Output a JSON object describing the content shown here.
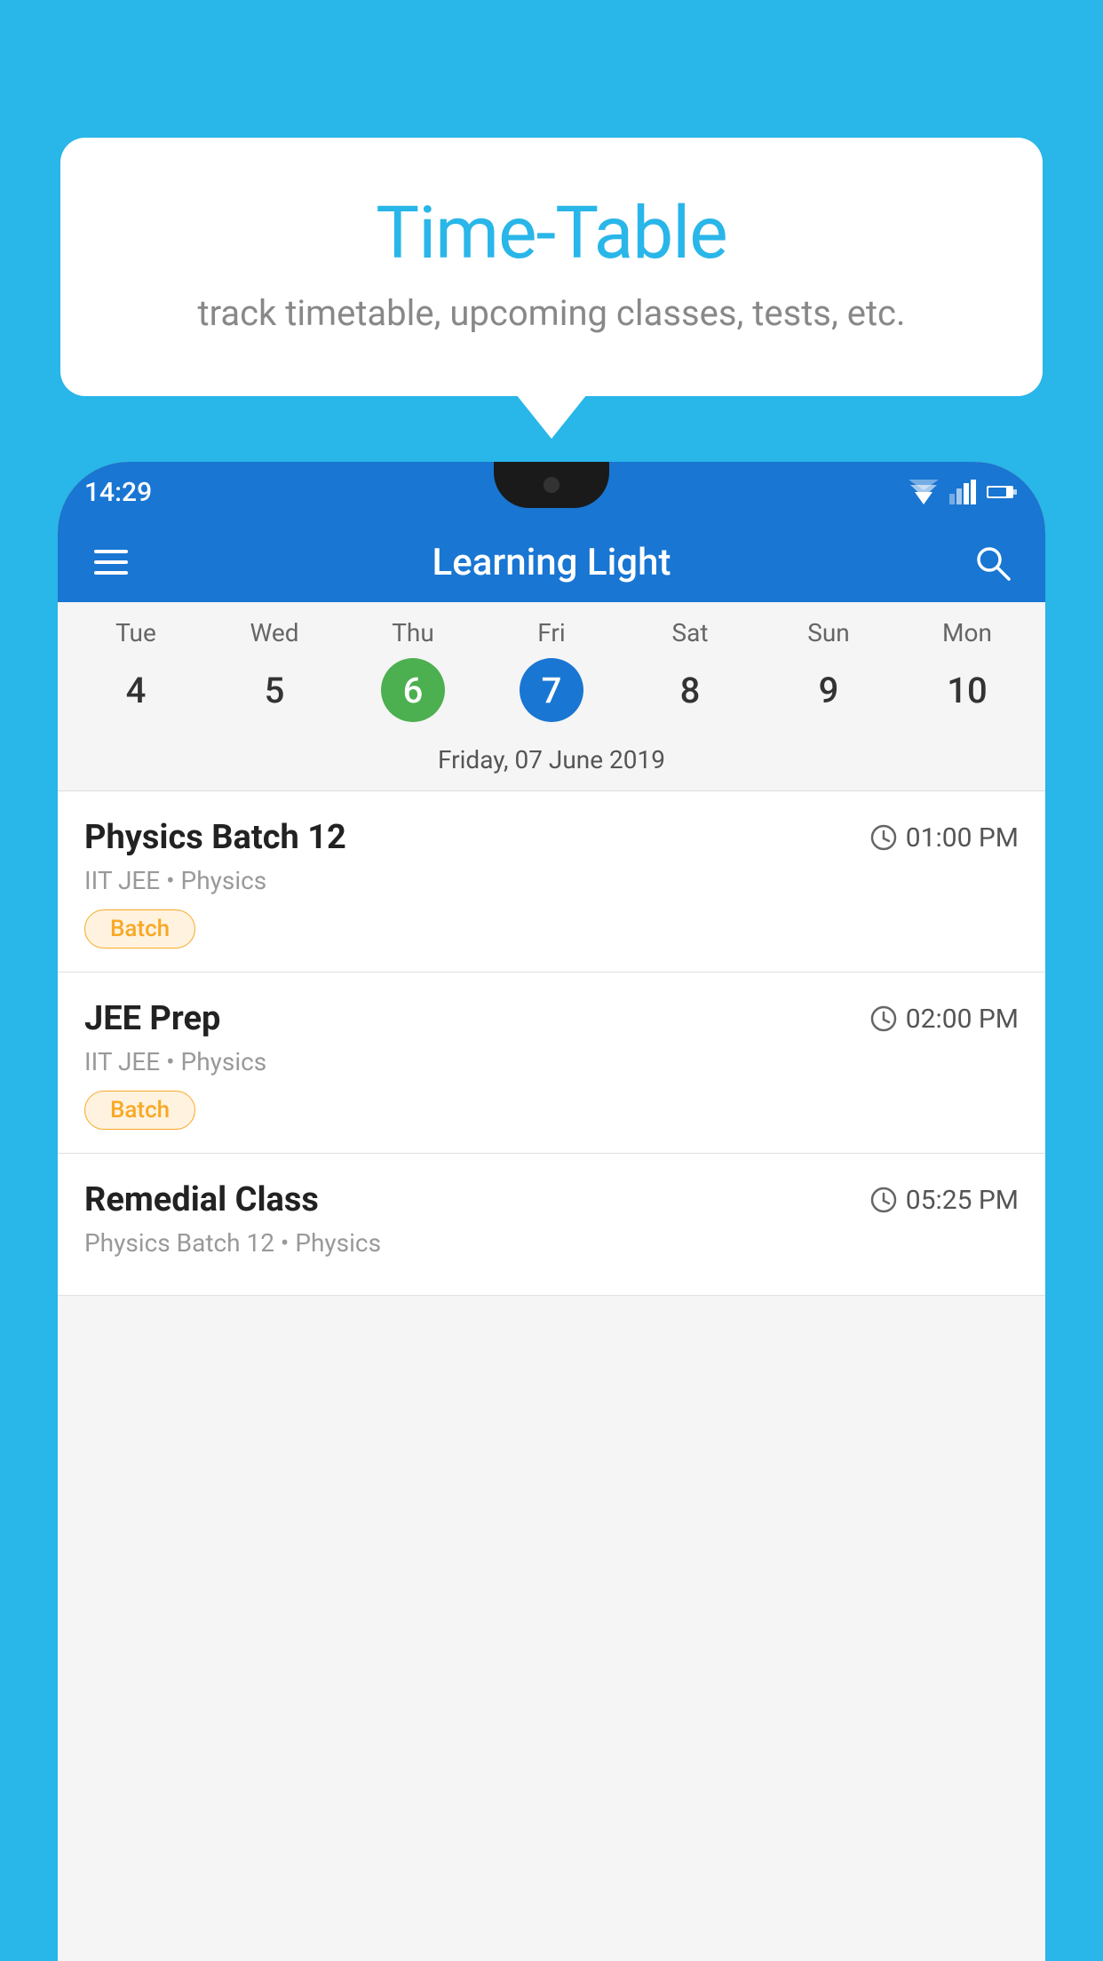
{
  "background": {
    "color": "#29B6E8"
  },
  "tooltip": {
    "title": "Time-Table",
    "subtitle": "track timetable, upcoming classes, tests, etc."
  },
  "phone": {
    "status_bar": {
      "time": "14:29"
    },
    "app_bar": {
      "title": "Learning Light",
      "menu_icon": "☰",
      "search_icon": "🔍"
    },
    "calendar": {
      "days": [
        {
          "name": "Tue",
          "num": "4",
          "state": "normal"
        },
        {
          "name": "Wed",
          "num": "5",
          "state": "normal"
        },
        {
          "name": "Thu",
          "num": "6",
          "state": "today"
        },
        {
          "name": "Fri",
          "num": "7",
          "state": "selected"
        },
        {
          "name": "Sat",
          "num": "8",
          "state": "normal"
        },
        {
          "name": "Sun",
          "num": "9",
          "state": "normal"
        },
        {
          "name": "Mon",
          "num": "10",
          "state": "normal"
        }
      ],
      "selected_date_label": "Friday, 07 June 2019"
    },
    "schedule": [
      {
        "title": "Physics Batch 12",
        "time": "01:00 PM",
        "meta": "IIT JEE • Physics",
        "badge": "Batch"
      },
      {
        "title": "JEE Prep",
        "time": "02:00 PM",
        "meta": "IIT JEE • Physics",
        "badge": "Batch"
      },
      {
        "title": "Remedial Class",
        "time": "05:25 PM",
        "meta": "Physics Batch 12 • Physics",
        "badge": null
      }
    ]
  }
}
